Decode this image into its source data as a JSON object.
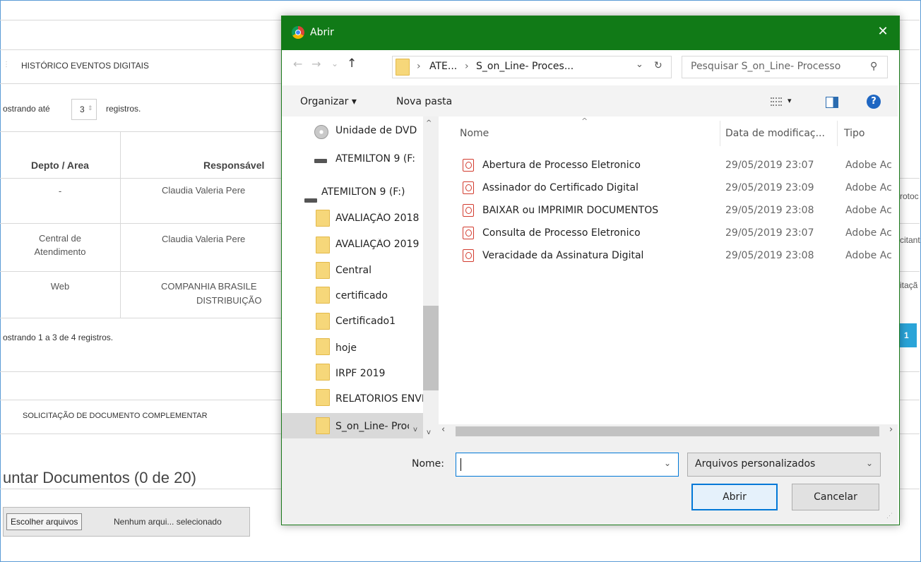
{
  "background": {
    "section1_title": "HISTÓRICO EVENTOS DIGITAIS",
    "showing_prefix": "ostrando até",
    "showing_count": "3",
    "showing_suffix": "registros.",
    "table": {
      "headers": [
        "Depto / Area",
        "Responsável"
      ],
      "rows": [
        {
          "depto": "-",
          "responsavel": "Claudia Valeria Pere",
          "right_fragment": "rotoc"
        },
        {
          "depto_line1": "Central de",
          "depto_line2": "Atendimento",
          "responsavel": "Claudia Valeria Pere",
          "right_fragment": "citant"
        },
        {
          "depto": "Web",
          "responsavel_line1": "COMPANHIA BRASILE",
          "responsavel_line2": "DISTRIBUIÇÃO",
          "right_fragment": "itaçã"
        }
      ]
    },
    "footer_info": "ostrando 1 a 3 de 4 registros.",
    "pagination_current": "1",
    "section2_title": "SOLICITAÇÃO DE DOCUMENTO COMPLEMENTAR",
    "attach_title": "untar Documentos (0 de 20)",
    "choose_files_label": "Escolher arquivos",
    "no_file_text": "Nenhum arqui... selecionado"
  },
  "dialog": {
    "title": "Abrir",
    "close_glyph": "✕",
    "nav": {
      "back": "←",
      "forward": "→",
      "dropdown": "⌄",
      "up": "↑"
    },
    "breadcrumb": {
      "sep1": "›",
      "part1": "ATE...",
      "sep2": "›",
      "part2": "S_on_Line- Proces...",
      "dropdown": "⌄",
      "refresh": "↻"
    },
    "search_placeholder": "Pesquisar S_on_Line- Processo",
    "search_glyph": "⚲",
    "toolbar": {
      "organize": "Organizar ▾",
      "new_folder": "Nova pasta",
      "view_dropdown": "▾",
      "help": "?"
    },
    "nav_pane": [
      {
        "label": "Unidade de DVD",
        "icon": "dvd"
      },
      {
        "label": "ATEMILTON 9 (F:",
        "icon": "drive"
      },
      {
        "label": "ATEMILTON 9 (F:)",
        "icon": "drive"
      },
      {
        "label": "AVALIAÇÃO 2018",
        "icon": "folder"
      },
      {
        "label": "AVALIAÇÃO 2019",
        "icon": "folder"
      },
      {
        "label": "Central",
        "icon": "folder"
      },
      {
        "label": "certificado",
        "icon": "folder"
      },
      {
        "label": "Certificado1",
        "icon": "folder"
      },
      {
        "label": "hoje",
        "icon": "folder"
      },
      {
        "label": "IRPF 2019",
        "icon": "folder"
      },
      {
        "label": "RELATÓRIOS ENVI",
        "icon": "folder"
      },
      {
        "label": "S_on_Line- Proce",
        "icon": "folder"
      }
    ],
    "columns": {
      "name": "Nome",
      "date": "Data de modificaç...",
      "type": "Tipo"
    },
    "files": [
      {
        "name": "Abertura de Processo Eletronico",
        "date": "29/05/2019 23:07",
        "type": "Adobe Ac"
      },
      {
        "name": "Assinador do Certificado Digital",
        "date": "29/05/2019 23:09",
        "type": "Adobe Ac"
      },
      {
        "name": "BAIXAR ou  IMPRIMIR DOCUMENTOS",
        "date": "29/05/2019 23:08",
        "type": "Adobe Ac"
      },
      {
        "name": "Consulta de Processo Eletronico",
        "date": "29/05/2019 23:07",
        "type": "Adobe Ac"
      },
      {
        "name": "Veracidade da Assinatura Digital",
        "date": "29/05/2019 23:08",
        "type": "Adobe Ac"
      }
    ],
    "filename_label": "Nome:",
    "filename_value": "",
    "filetype_value": "Arquivos personalizados",
    "open_button": "Abrir",
    "cancel_button": "Cancelar",
    "colors": {
      "titlebar": "#117a17",
      "primary_border": "#0078d7",
      "pdf_red": "#d23b2e",
      "folder_yellow": "#f6d77a"
    }
  }
}
